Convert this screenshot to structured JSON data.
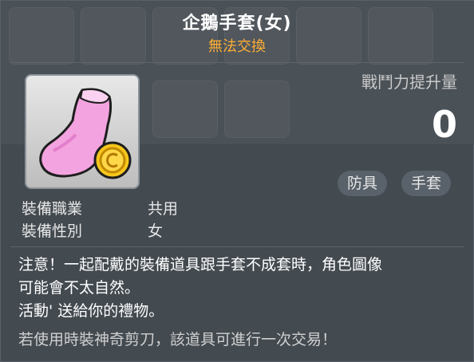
{
  "item": {
    "name": "企鵝手套(女)",
    "trade_status": "無法交換"
  },
  "power": {
    "label": "戰鬥力提升量",
    "value": "0"
  },
  "tags": [
    "防具",
    "手套"
  ],
  "stats": [
    {
      "label": "裝備職業",
      "value": "共用"
    },
    {
      "label": "裝備性別",
      "value": "女"
    }
  ],
  "description": {
    "line1": "注意！一起配戴的裝備道具跟手套不成套時，角色圖像",
    "line2": "可能會不太自然。",
    "line3": "活動' 送給你的禮物。"
  },
  "note": "若使用時裝神奇剪刀，該道具可進行一次交易！",
  "icon": "pink-glove-with-gold-coin-icon",
  "colors": {
    "trade_status": "#ffae33",
    "background": "#434a50"
  }
}
